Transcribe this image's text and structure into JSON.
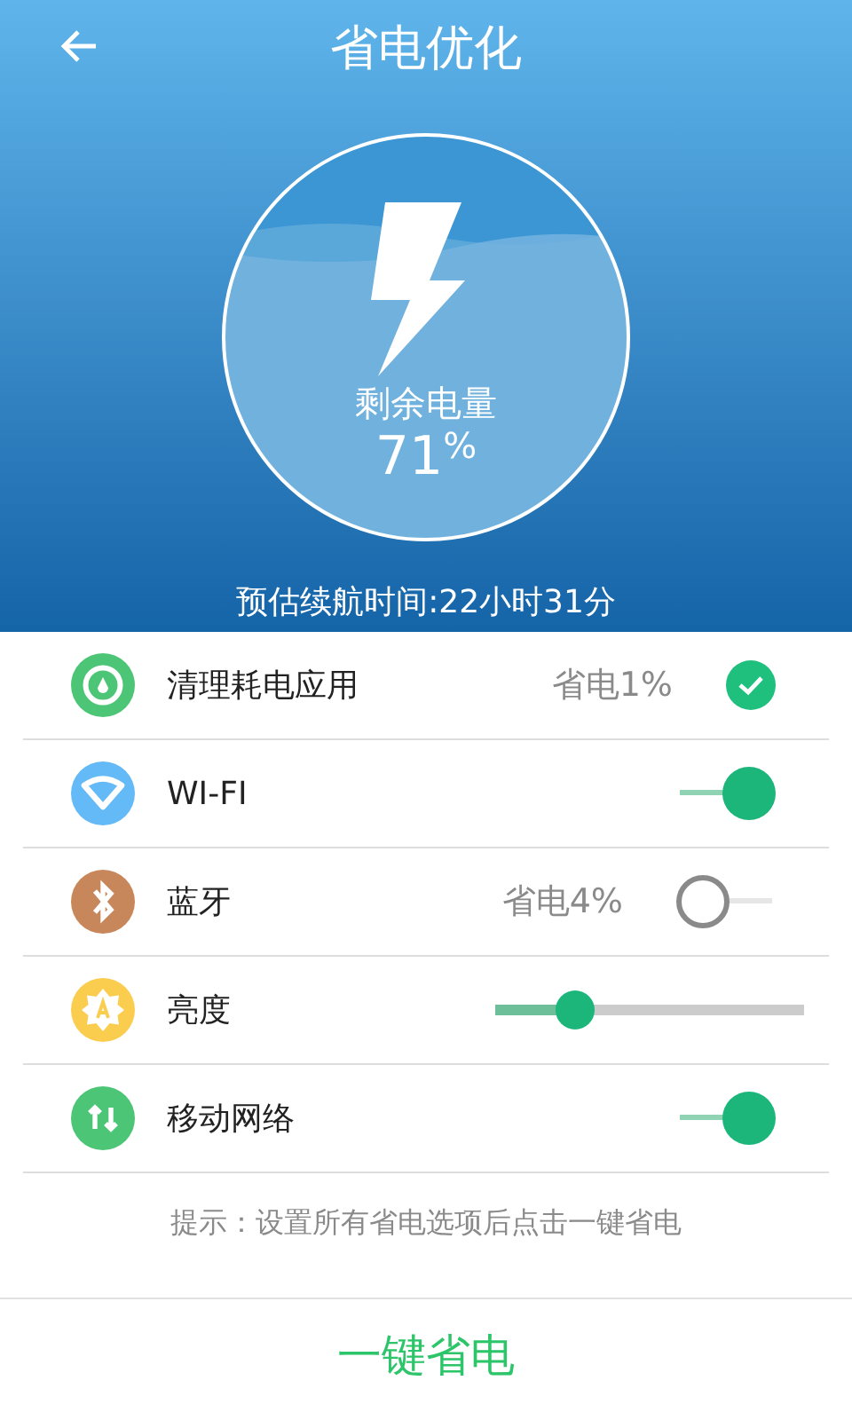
{
  "header": {
    "title": "省电优化",
    "battery_label": "剩余电量",
    "battery_value": "71",
    "battery_unit": "%",
    "estimate": "预估续航时间:22小时31分"
  },
  "items": [
    {
      "kind": "check",
      "label": "清理耗电应用",
      "saving": "省电1%",
      "checked": true,
      "color": "#4cc676"
    },
    {
      "kind": "toggle",
      "label": "WI-FI",
      "on": true,
      "color": "#64b9f7"
    },
    {
      "kind": "toggle",
      "label": "蓝牙",
      "saving": "省电4%",
      "on": false,
      "color": "#c8875a"
    },
    {
      "kind": "slider",
      "label": "亮度",
      "level": 0.26,
      "color": "#fbcd4f"
    },
    {
      "kind": "toggle",
      "label": "移动网络",
      "on": true,
      "color": "#4cc676"
    }
  ],
  "hint": "提示：设置所有省电选项后点击一键省电",
  "action_button": "一键省电"
}
